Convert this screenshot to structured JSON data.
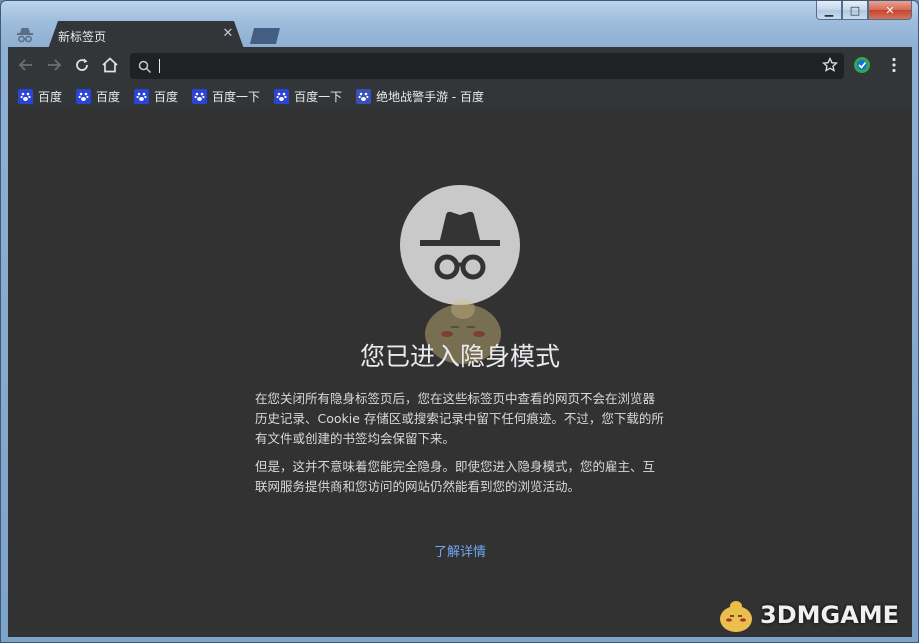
{
  "window": {
    "minimize_glyph": "▁",
    "maximize_glyph": "□",
    "close_glyph": "✕"
  },
  "tab": {
    "title": "新标签页",
    "close_glyph": "✕"
  },
  "omnibox": {
    "value": "",
    "placeholder": ""
  },
  "bookmarks": [
    {
      "label": "百度",
      "icon": "baidu-paw-icon"
    },
    {
      "label": "百度",
      "icon": "baidu-paw-icon"
    },
    {
      "label": "百度",
      "icon": "baidu-paw-icon"
    },
    {
      "label": "百度一下",
      "icon": "baidu-paw-icon"
    },
    {
      "label": "百度一下",
      "icon": "baidu-paw-icon"
    },
    {
      "label": "绝地战警手游 - 百度",
      "icon": "baidu-paw-icon"
    }
  ],
  "content": {
    "headline": "您已进入隐身模式",
    "paragraph1": "在您关闭所有隐身标签页后，您在这些标签页中查看的网页不会在浏览器历史记录、Cookie 存储区或搜索记录中留下任何痕迹。不过，您下载的所有文件或创建的书签均会保留下来。",
    "paragraph2": "但是，这并不意味着您能完全隐身。即使您进入隐身模式，您的雇主、互联网服务提供商和您访问的网站仍然能看到您的浏览活动。",
    "learn_more": "了解详情"
  },
  "watermark": {
    "text": "3DMGAME"
  },
  "colors": {
    "toolbar_bg": "#323639",
    "content_bg": "#323232",
    "link": "#6ea7f5",
    "bookmark_icon": "#2b43d6"
  }
}
